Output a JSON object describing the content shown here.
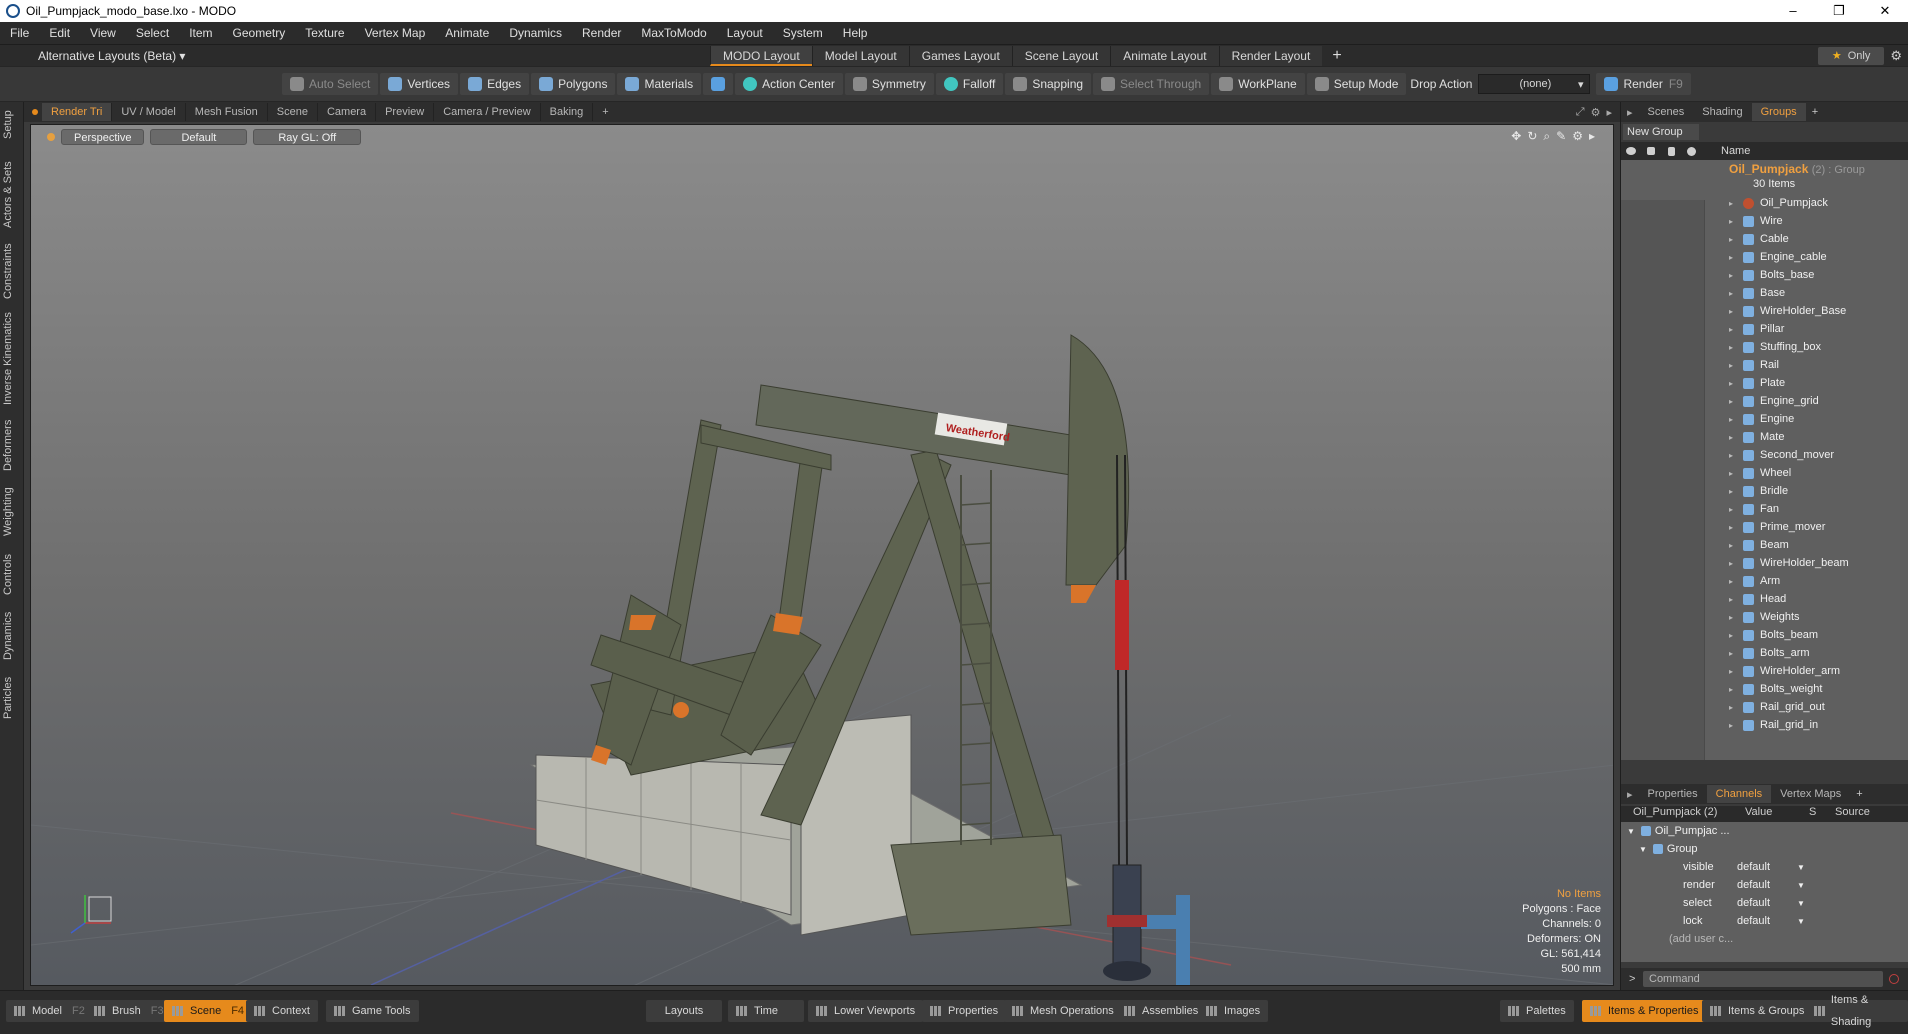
{
  "window": {
    "title": "Oil_Pumpjack_modo_base.lxo - MODO",
    "minimize": "–",
    "restore": "❐",
    "close": "✕"
  },
  "menu": [
    "File",
    "Edit",
    "View",
    "Select",
    "Item",
    "Geometry",
    "Texture",
    "Vertex Map",
    "Animate",
    "Dynamics",
    "Render",
    "MaxToModo",
    "Layout",
    "System",
    "Help"
  ],
  "layout": {
    "alt_layouts": "Alternative Layouts (Beta) ▾",
    "tabs": [
      "MODO Layout",
      "Model Layout",
      "Games Layout",
      "Scene Layout",
      "Animate Layout",
      "Render Layout"
    ],
    "active_tab": "MODO Layout",
    "add": "+",
    "only": "Only",
    "only_star": "★",
    "gear": "⚙"
  },
  "toolbar": {
    "auto_select": "Auto Select",
    "vertices": "Vertices",
    "edges": "Edges",
    "polygons": "Polygons",
    "materials": "Materials",
    "action_center": "Action Center",
    "symmetry": "Symmetry",
    "falloff": "Falloff",
    "snapping": "Snapping",
    "select_through": "Select Through",
    "workplane": "WorkPlane",
    "setup_mode": "Setup Mode",
    "drop_action": "Drop Action",
    "drop_value": "(none)",
    "render": "Render",
    "render_key": "F9"
  },
  "left_tabs": [
    "Setup",
    "Actors & Sets",
    "Constraints",
    "Inverse Kinematics",
    "Deformers",
    "Weighting",
    "Controls",
    "Dynamics",
    "Particles"
  ],
  "viewport_tabs": [
    "Render Tri",
    "UV / Model",
    "Mesh Fusion",
    "Scene",
    "Camera",
    "Preview",
    "Camera / Preview",
    "Baking"
  ],
  "viewport_add": "+",
  "viewport": {
    "view": "Perspective",
    "shading": "Default",
    "raygl": "Ray GL: Off",
    "brand": "Weatherford",
    "hud": {
      "no_items": "No Items",
      "polygons": "Polygons : Face",
      "channels": "Channels: 0",
      "deformers": "Deformers: ON",
      "gl": "GL: 561,414",
      "scale": "500 mm"
    }
  },
  "right_tabs": [
    "Scenes",
    "Shading",
    "Groups"
  ],
  "right_add": "+",
  "groups": {
    "new_group": "New Group",
    "col_name": "Name",
    "root_name": "Oil_Pumpjack",
    "root_type": "(2) : Group",
    "count": "30 Items",
    "items": [
      "Oil_Pumpjack",
      "Wire",
      "Cable",
      "Engine_cable",
      "Bolts_base",
      "Base",
      "WireHolder_Base",
      "Pillar",
      "Stuffing_box",
      "Rail",
      "Plate",
      "Engine_grid",
      "Engine",
      "Mate",
      "Second_mover",
      "Wheel",
      "Bridle",
      "Fan",
      "Prime_mover",
      "Beam",
      "WireHolder_beam",
      "Arm",
      "Head",
      "Weights",
      "Bolts_beam",
      "Bolts_arm",
      "WireHolder_arm",
      "Bolts_weight",
      "Rail_grid_out",
      "Rail_grid_in"
    ]
  },
  "channel_tabs": [
    "Properties",
    "Channels",
    "Vertex Maps"
  ],
  "channel_add": "+",
  "channels": {
    "header": {
      "item": "Oil_Pumpjack (2)",
      "value": "Value",
      "s": "S",
      "source": "Source"
    },
    "tree_root": "Oil_Pumpjac ...",
    "tree_group": "Group",
    "rows": [
      {
        "name": "visible",
        "value": "default"
      },
      {
        "name": "render",
        "value": "default"
      },
      {
        "name": "select",
        "value": "default"
      },
      {
        "name": "lock",
        "value": "default"
      }
    ],
    "add_user": "(add user c..."
  },
  "command": {
    "prompt": ">",
    "placeholder": "Command"
  },
  "statusbar": {
    "model": "Model",
    "model_key": "F2",
    "brush": "Brush",
    "brush_key": "F3",
    "scene": "Scene",
    "scene_key": "F4",
    "context": "Context",
    "game_tools": "Game Tools",
    "layouts": "Layouts",
    "time": "Time",
    "lower_viewports": "Lower Viewports",
    "properties": "Properties",
    "mesh_operations": "Mesh Operations",
    "assemblies": "Assemblies",
    "images": "Images",
    "palettes": "Palettes",
    "items_properties": "Items & Properties",
    "items_groups": "Items & Groups",
    "items_shading": "Items & Shading"
  },
  "colors": {
    "accent": "#e68a1c",
    "selected_text": "#f0a040",
    "mesh_icon": "#7fb0e0",
    "pumpjack": "#5e6350"
  }
}
